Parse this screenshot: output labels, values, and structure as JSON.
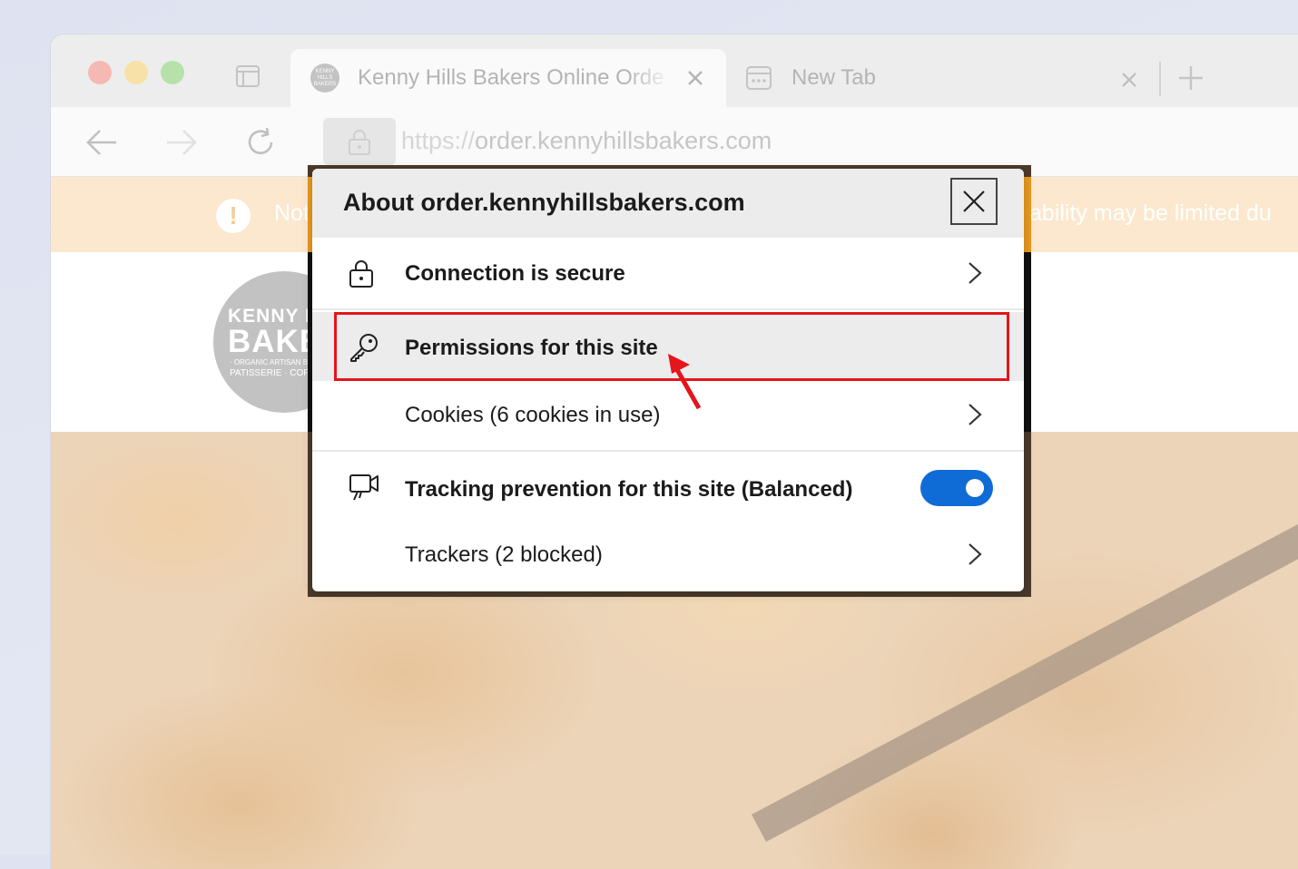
{
  "browser": {
    "tabs": [
      {
        "title": "Kenny Hills Bakers Online Orde",
        "favicon_text": "KENNY HILLS BAKERS",
        "active": true
      },
      {
        "title": "New Tab",
        "active": false
      }
    ],
    "address": {
      "scheme": "https://",
      "host": "order.kennyhillsbakers.com"
    }
  },
  "notice": {
    "left_text": "Not",
    "right_text": "ilability may be limited du"
  },
  "logo": {
    "line1": "KENNY HILLS",
    "line2": "BAKERS",
    "line3": "· ORGANIC ARTISAN BREAD ·",
    "line4": "PATISSERIE · COFFEE"
  },
  "popup": {
    "title": "About order.kennyhillsbakers.com",
    "rows": [
      {
        "label": "Connection is secure",
        "icon": "lock-icon"
      },
      {
        "label": "Permissions for this site",
        "icon": "key-icon"
      },
      {
        "label": "Cookies (6 cookies in use)"
      },
      {
        "label": "Tracking prevention for this site (Balanced)",
        "icon": "tracking-icon",
        "toggle_on": true
      },
      {
        "label": "Trackers (2 blocked)"
      }
    ]
  },
  "colors": {
    "accent": "#0f6cd6",
    "highlight": "#e4151b",
    "notice_bg": "#fce8cf"
  }
}
